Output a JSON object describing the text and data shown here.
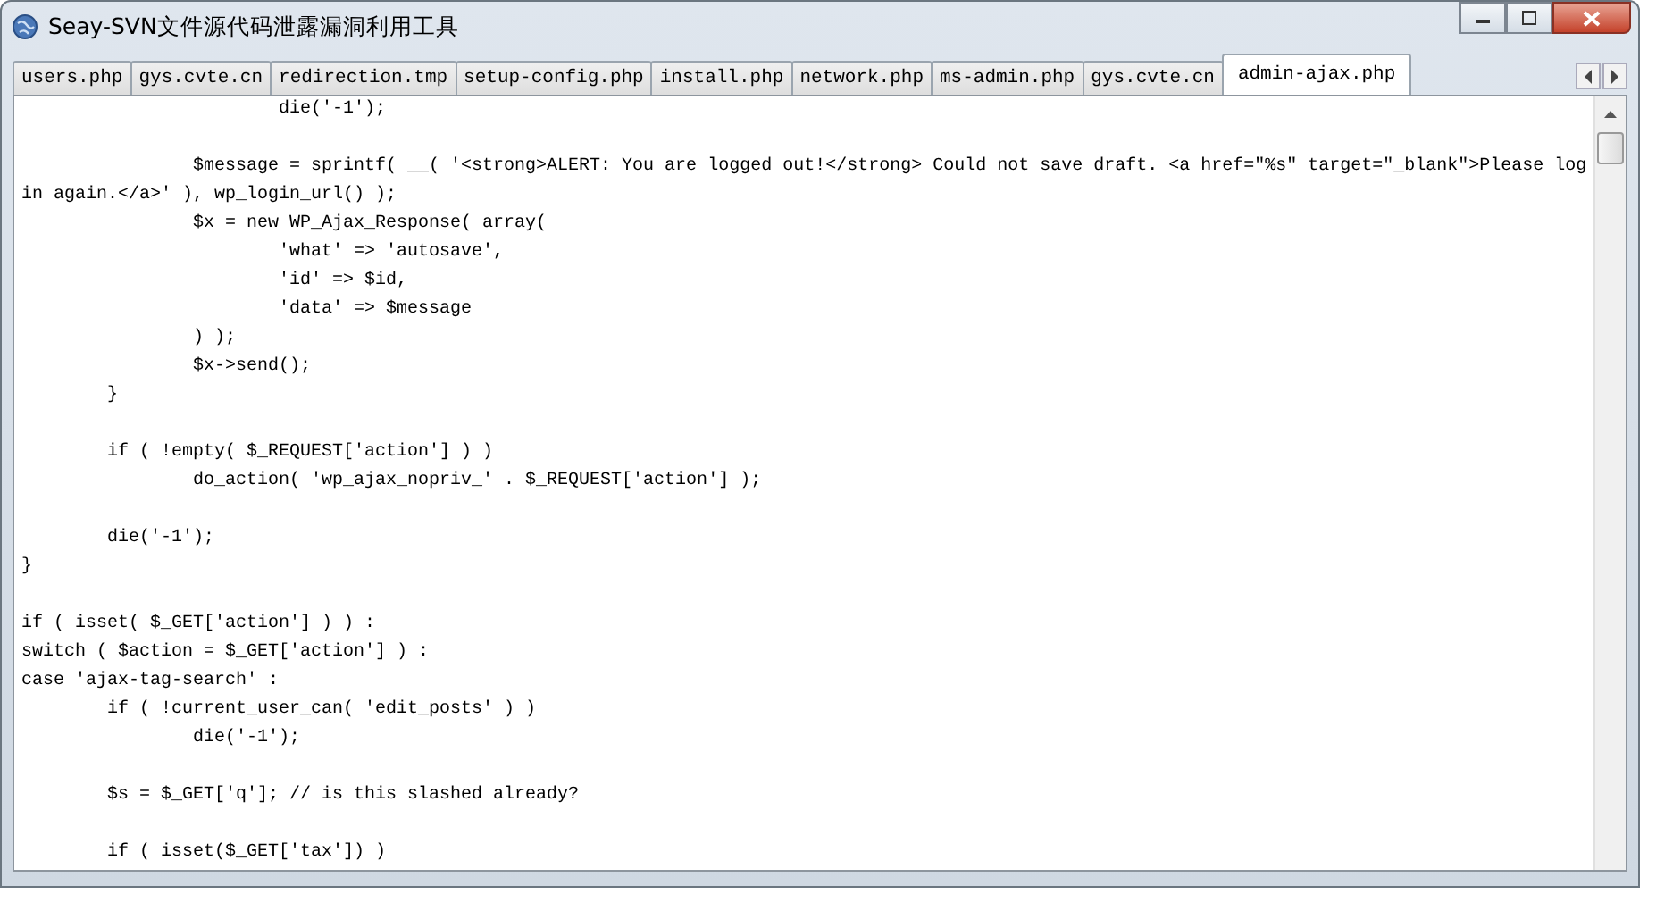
{
  "window": {
    "title": "Seay-SVN文件源代码泄露漏洞利用工具"
  },
  "tabs": [
    {
      "label": "users.php",
      "selected": false
    },
    {
      "label": "gys.cvte.cn",
      "selected": false
    },
    {
      "label": "redirection.tmp",
      "selected": false
    },
    {
      "label": "setup-config.php",
      "selected": false
    },
    {
      "label": "install.php",
      "selected": false
    },
    {
      "label": "network.php",
      "selected": false
    },
    {
      "label": "ms-admin.php",
      "selected": false
    },
    {
      "label": "gys.cvte.cn",
      "selected": false
    },
    {
      "label": "admin-ajax.php",
      "selected": true
    }
  ],
  "editor": {
    "code": "\t\t\tdie('-1');\n\n\t\t$message = sprintf( __( '<strong>ALERT: You are logged out!</strong> Could not save draft. <a href=\"%s\" target=\"_blank\">Please log\nin again.</a>' ), wp_login_url() );\n\t\t$x = new WP_Ajax_Response( array(\n\t\t\t'what' => 'autosave',\n\t\t\t'id' => $id,\n\t\t\t'data' => $message\n\t\t) );\n\t\t$x->send();\n\t}\n\n\tif ( !empty( $_REQUEST['action'] ) )\n\t\tdo_action( 'wp_ajax_nopriv_' . $_REQUEST['action'] );\n\n\tdie('-1');\n}\n\nif ( isset( $_GET['action'] ) ) :\nswitch ( $action = $_GET['action'] ) :\ncase 'ajax-tag-search' :\n\tif ( !current_user_can( 'edit_posts' ) )\n\t\tdie('-1');\n\n\t$s = $_GET['q']; // is this slashed already?\n\n\tif ( isset($_GET['tax']) )"
  }
}
